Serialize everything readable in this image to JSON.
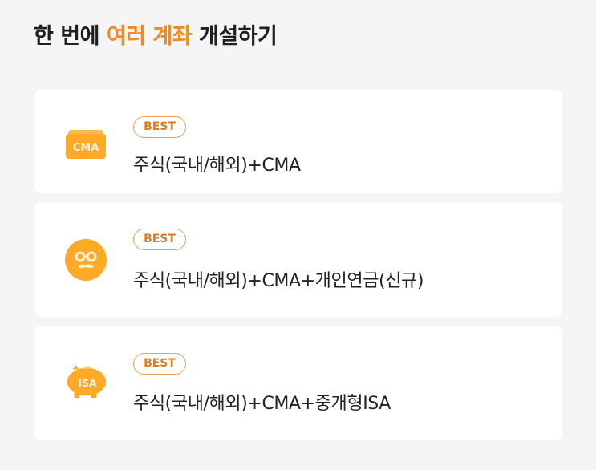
{
  "heading": {
    "prefix": "한 번에 ",
    "accent": "여러 계좌",
    "suffix": " 개설하기"
  },
  "colors": {
    "accent": "#f08a24",
    "icon_orange": "#ffa928",
    "card_bg": "#ffffff",
    "page_bg": "#f5f5f7"
  },
  "cards": [
    {
      "icon": "cma-wallet-icon",
      "icon_label": "CMA",
      "badge": "BEST",
      "title": "주식(국내/해외)+CMA"
    },
    {
      "icon": "pension-face-icon",
      "badge": "BEST",
      "title": "주식(국내/해외)+CMA+개인연금(신규)"
    },
    {
      "icon": "isa-piggy-bank-icon",
      "icon_label": "ISA",
      "badge": "BEST",
      "title": "주식(국내/해외)+CMA+중개형ISA"
    }
  ]
}
